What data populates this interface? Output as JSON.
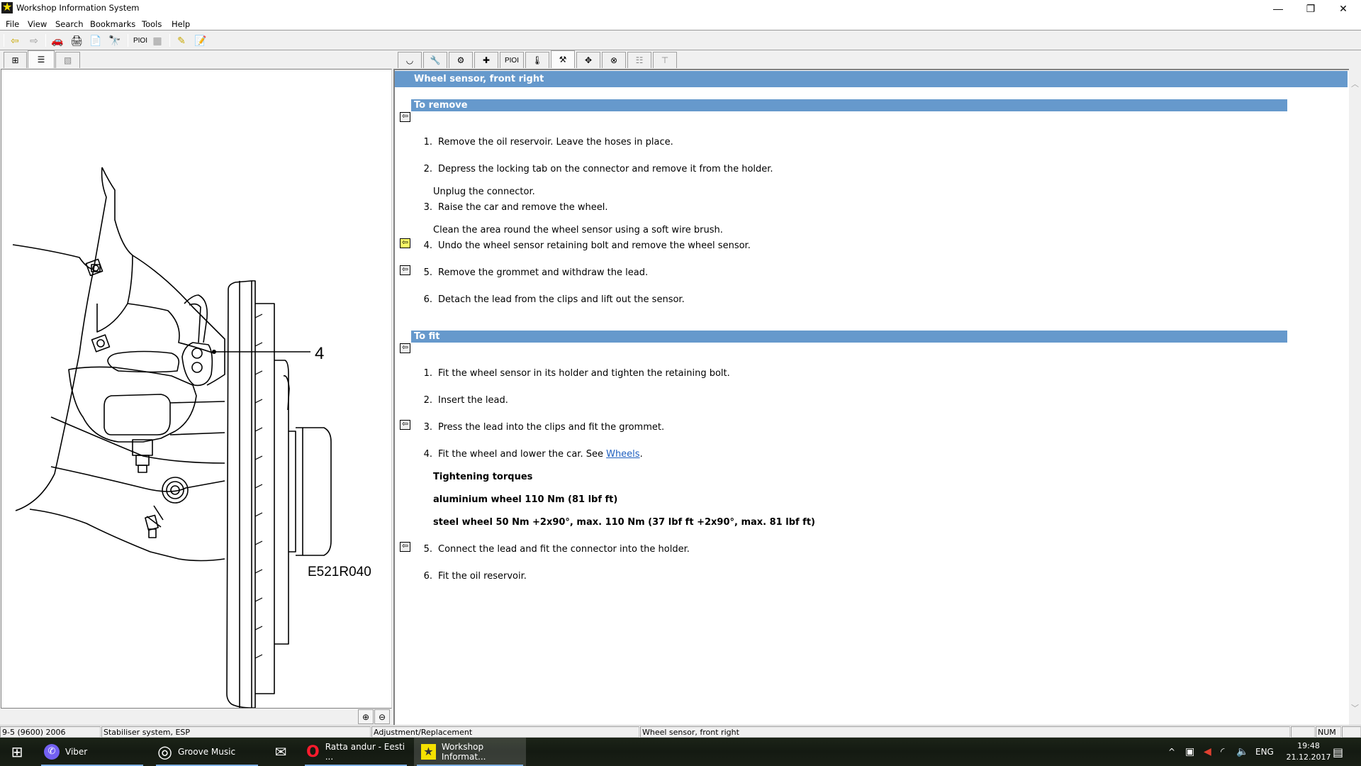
{
  "window": {
    "title": "Workshop Information System",
    "controls": {
      "minimize": "—",
      "restore": "❐",
      "close": "✕"
    }
  },
  "menu": [
    "File",
    "View",
    "Search",
    "Bookmarks",
    "Tools",
    "Help"
  ],
  "toolbar": {
    "items": [
      {
        "name": "back-icon",
        "glyph": "⇦"
      },
      {
        "name": "forward-icon",
        "glyph": "⇨"
      },
      {
        "name": "car-icon",
        "glyph": "🚗"
      },
      {
        "name": "printer-icon",
        "glyph": "🖨"
      },
      {
        "name": "document-download-icon",
        "glyph": "📄"
      },
      {
        "name": "binoculars-icon",
        "glyph": "🔭"
      },
      {
        "name": "pioi-text",
        "glyph": "PIOI"
      },
      {
        "name": "diagnostic-tool-icon",
        "glyph": "▦"
      },
      {
        "name": "pencil-icon",
        "glyph": "✎"
      },
      {
        "name": "note-pencil-icon",
        "glyph": "📝"
      }
    ]
  },
  "left_tabs": [
    {
      "name": "tab-tree",
      "glyph": "⊞"
    },
    {
      "name": "tab-document",
      "glyph": "☰"
    },
    {
      "name": "tab-image",
      "glyph": "▧"
    }
  ],
  "content_tabs": [
    {
      "name": "tab-wheel-icon",
      "glyph": "◡"
    },
    {
      "name": "tab-wrench-icon",
      "glyph": "🔧"
    },
    {
      "name": "tab-gears-icon",
      "glyph": "⚙"
    },
    {
      "name": "tab-first-aid-icon",
      "glyph": "✚"
    },
    {
      "name": "tab-pioi-icon",
      "glyph": "PIOI"
    },
    {
      "name": "tab-thermometer-icon",
      "glyph": "🌡"
    },
    {
      "name": "tab-tools-icon",
      "glyph": "⚒"
    },
    {
      "name": "tab-move-icon",
      "glyph": "✥"
    },
    {
      "name": "tab-sensor-icon",
      "glyph": "⊗"
    },
    {
      "name": "tab-list-icon",
      "glyph": "☷"
    },
    {
      "name": "tab-shirt-icon",
      "glyph": "⊤"
    }
  ],
  "illustration": {
    "callout": "4",
    "figure_id": "E521R040"
  },
  "document": {
    "title": "Wheel sensor, front right",
    "sections": [
      {
        "heading": "To remove",
        "steps": [
          {
            "num": "1.",
            "text": "Remove the oil reservoir. Leave the hoses in place."
          },
          {
            "num": "2.",
            "text": "Depress the locking tab on the connector and remove it from the holder.",
            "note": "Unplug the connector."
          },
          {
            "num": "3.",
            "text": "Raise the car and remove the wheel.",
            "note": "Clean the area round the wheel sensor using a soft wire brush."
          },
          {
            "num": "4.",
            "text": "Undo the wheel sensor retaining bolt and remove the wheel sensor."
          },
          {
            "num": "5.",
            "text": "Remove the grommet and withdraw the lead."
          },
          {
            "num": "6.",
            "text": "Detach the lead from the clips and lift out the sensor."
          }
        ]
      },
      {
        "heading": "To fit",
        "steps": [
          {
            "num": "1.",
            "text": "Fit the wheel sensor in its holder and tighten the retaining bolt."
          },
          {
            "num": "2.",
            "text": "Insert the lead."
          },
          {
            "num": "3.",
            "text": "Press the lead into the clips and fit the grommet."
          },
          {
            "num": "4.",
            "text": "Fit the wheel and lower the car. See ",
            "link": "Wheels",
            "after": "."
          },
          {
            "num": "5.",
            "text": "Connect the lead and fit the connector into the holder."
          },
          {
            "num": "6.",
            "text": "Fit the oil reservoir."
          }
        ],
        "torques": {
          "heading": "Tightening torques",
          "lines": [
            "aluminium wheel 110 Nm (81 lbf ft)",
            "steel wheel 50 Nm +2x90°, max. 110 Nm (37 lbf ft +2x90°, max. 81 lbf ft)"
          ]
        }
      }
    ]
  },
  "zoom_buttons": {
    "zoom_in": "⊕",
    "zoom_out": "⊖"
  },
  "status": {
    "model": "9-5 (9600) 2006",
    "system": "Stabiliser system, ESP",
    "operation": "Adjustment/Replacement",
    "item": "Wheel sensor, front right",
    "blank": "",
    "num": "NUM"
  },
  "taskbar": {
    "start_glyph": "⊞",
    "apps": [
      {
        "label": "Viber",
        "glyph": "✆",
        "color": "#7360f2"
      },
      {
        "label": "Groove Music",
        "glyph": "◎",
        "color": "#ffffff"
      },
      {
        "label": "",
        "glyph": "✉",
        "color": "#ffffff"
      },
      {
        "label": "Ratta andur - Eesti ...",
        "glyph": "O",
        "color": "#ff1b2d"
      },
      {
        "label": "Workshop Informat...",
        "glyph": "★",
        "color": "#f5e000"
      }
    ],
    "tray": {
      "chevron": "^",
      "language": "ENG",
      "time": "19:48",
      "date": "21.12.2017"
    }
  },
  "colors": {
    "heading_bar": "#6699cc",
    "link": "#1f5fbf"
  }
}
